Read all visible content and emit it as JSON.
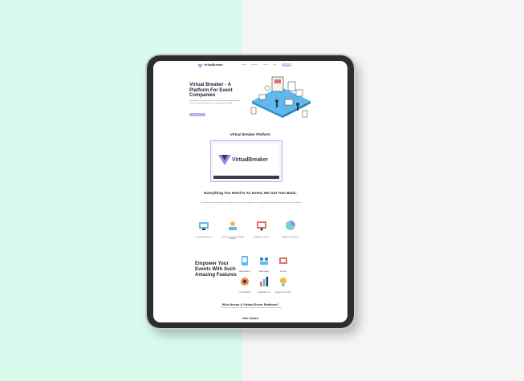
{
  "brand": {
    "name": "VirtualBreaker",
    "accent": "#bfa8ee",
    "bg_left": "#d9fbee"
  },
  "nav": {
    "links": [
      "Home",
      "Features",
      "Pricing",
      "Blog",
      "Contact"
    ],
    "cta": "Get Started"
  },
  "hero": {
    "title": "Virtual Breaker - A Platform For Event Companies",
    "text": "Virtual Breaker is a platform that lets event companies host engaging virtual events, with tools for registration, live streaming and networking.",
    "button": "Learn more"
  },
  "platform": {
    "title": "Virtual Breaker Platform",
    "video_text": "VirtualBreaker"
  },
  "everything": {
    "title": "Everything You Need In An Event, We Got Your Back.",
    "text": "Virtual Breaker gives event organizers everything they need to host an engaging event, from registration and ticketing to live sessions and interactive features.",
    "features": [
      {
        "label": "Create Branded Events",
        "icon": "branding-icon"
      },
      {
        "label": "Live Stream Sessions To Engage Audience",
        "icon": "stream-icon"
      },
      {
        "label": "Multiple Event Formats",
        "icon": "formats-icon"
      },
      {
        "label": "Analytics For Organizers",
        "icon": "analytics-icon"
      }
    ]
  },
  "empower": {
    "title": "Empower Your Events With Such Amazing Features",
    "features": [
      {
        "label": "REGISTRATION",
        "icon": "registration-icon"
      },
      {
        "label": "NETWORKING",
        "icon": "networking-icon"
      },
      {
        "label": "SECURE",
        "icon": "secure-icon"
      },
      {
        "label": "CUSTOMIZABLE",
        "icon": "customizable-icon"
      },
      {
        "label": "DATA ANALYTICS",
        "icon": "data-analytics-icon"
      },
      {
        "label": "ONE-STOP SOLUTION",
        "icon": "solution-icon"
      }
    ]
  },
  "who": {
    "title": "Who Needs A Virtual Event Platform?",
    "text": "Event planners, corporations, associations and educators all benefit from hosting virtual events."
  },
  "use_cases": {
    "title": "Use Cases"
  }
}
